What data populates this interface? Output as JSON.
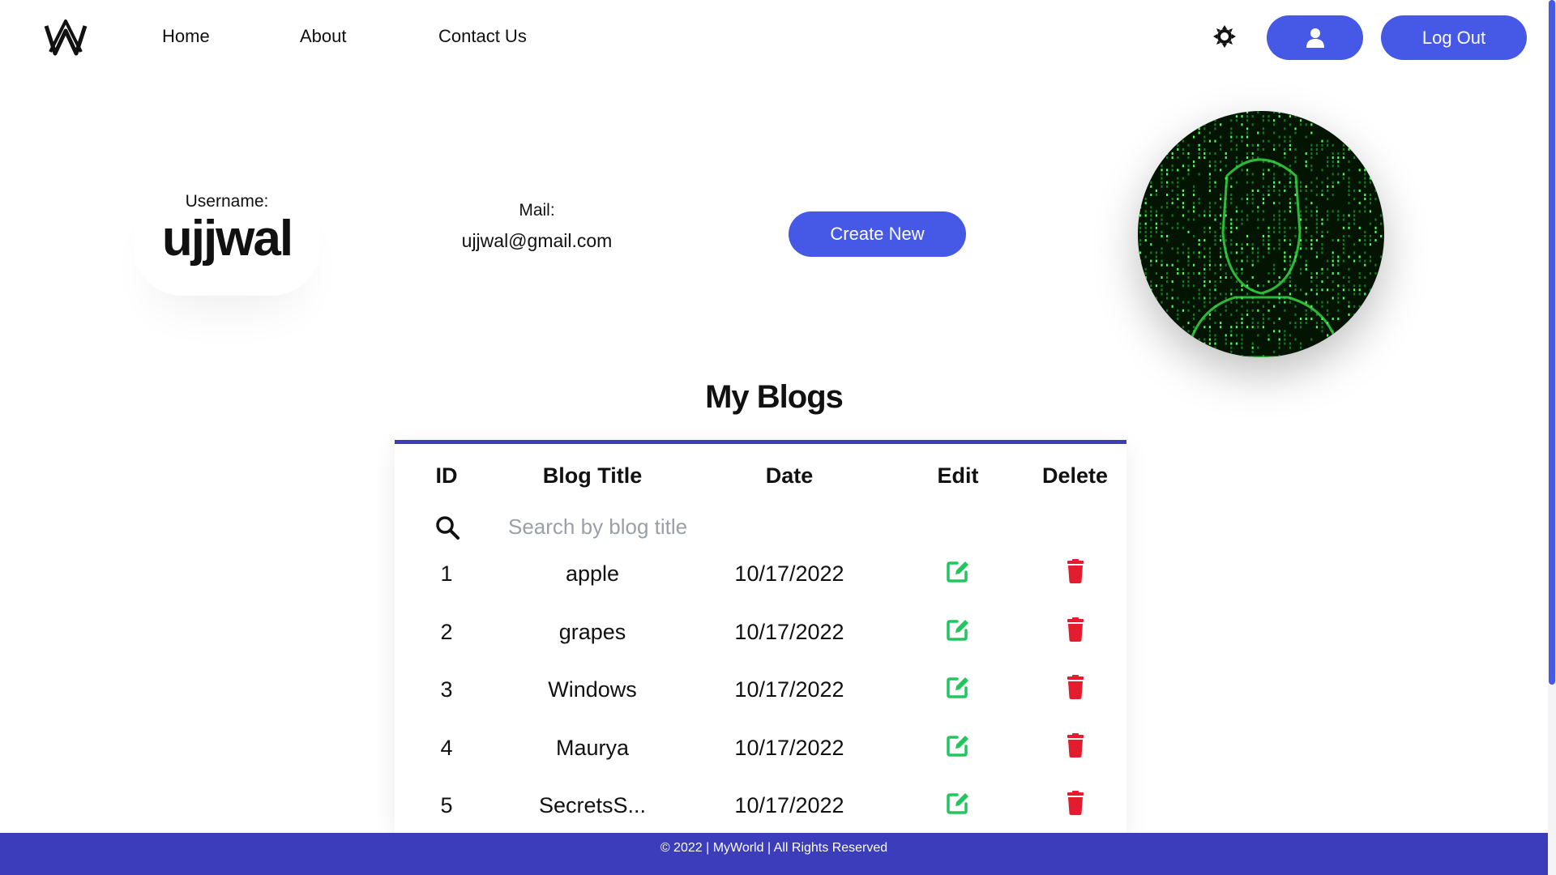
{
  "nav": {
    "links": [
      "Home",
      "About",
      "Contact Us"
    ],
    "logout_label": "Log Out"
  },
  "profile": {
    "username_label": "Username:",
    "username": "ujjwal",
    "mail_label": "Mail:",
    "mail": "ujjwal@gmail.com",
    "create_label": "Create New"
  },
  "blogs": {
    "title": "My Blogs",
    "headers": {
      "id": "ID",
      "title": "Blog Title",
      "date": "Date",
      "edit": "Edit",
      "delete": "Delete"
    },
    "search_placeholder": "Search by blog title",
    "rows": [
      {
        "id": "1",
        "title": "apple",
        "date": "10/17/2022"
      },
      {
        "id": "2",
        "title": "grapes",
        "date": "10/17/2022"
      },
      {
        "id": "3",
        "title": "Windows",
        "date": "10/17/2022"
      },
      {
        "id": "4",
        "title": "Maurya",
        "date": "10/17/2022"
      },
      {
        "id": "5",
        "title": "SecretsS...",
        "date": "10/17/2022"
      }
    ]
  },
  "footer": {
    "text": "© 2022 | MyWorld | All Rights Reserved"
  },
  "colors": {
    "accent": "#4558e6",
    "footer": "#3b3dbb",
    "edit": "#22c55e",
    "delete": "#e11d2e"
  }
}
